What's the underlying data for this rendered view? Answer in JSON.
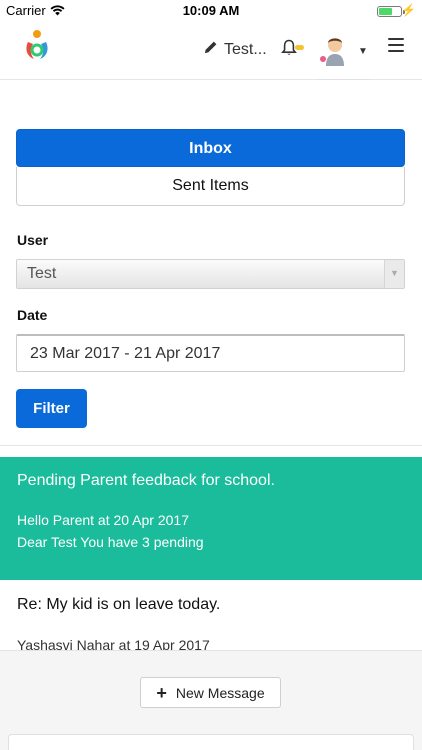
{
  "status_bar": {
    "carrier": "Carrier",
    "time": "10:09 AM"
  },
  "header": {
    "user_name": "Test...",
    "icons": {
      "logo": "app-logo-icon",
      "edit": "pencil-icon",
      "bell": "bell-icon",
      "avatar": "user-avatar-icon",
      "caret": "caret-down-icon",
      "menu": "hamburger-menu-icon"
    },
    "colors": {
      "notification_dot": "#f4c430"
    }
  },
  "tabs": {
    "inbox": "Inbox",
    "sent": "Sent Items",
    "active": "Inbox"
  },
  "filters": {
    "user_label": "User",
    "user_value": "Test",
    "date_label": "Date",
    "date_value": "23 Mar 2017 - 21 Apr 2017",
    "filter_button": "Filter"
  },
  "messages": [
    {
      "subject": "Pending Parent feedback for school.",
      "from_line": "Hello Parent at 20 Apr 2017",
      "preview": "Dear Test You have 3 pending",
      "highlighted": true
    },
    {
      "subject": "Re: My kid is on leave today.",
      "from_line": "Yashasvi Nahar at 19 Apr 2017"
    }
  ],
  "footer": {
    "new_message": "New Message"
  },
  "colors": {
    "primary": "#0a6ad9",
    "highlight": "#1abc9c"
  }
}
